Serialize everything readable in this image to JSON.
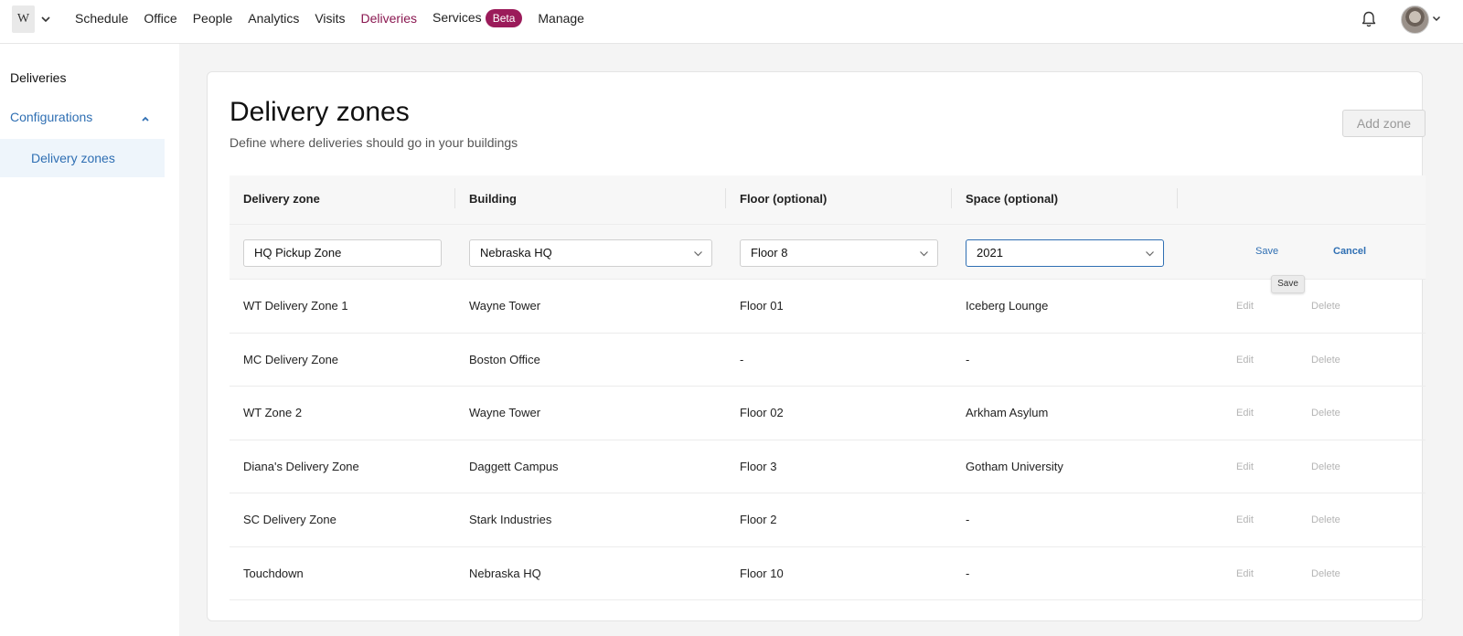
{
  "topnav": {
    "logo_text": "W",
    "items": [
      {
        "label": "Schedule",
        "active": false
      },
      {
        "label": "Office",
        "active": false
      },
      {
        "label": "People",
        "active": false
      },
      {
        "label": "Analytics",
        "active": false
      },
      {
        "label": "Visits",
        "active": false
      },
      {
        "label": "Deliveries",
        "active": true
      },
      {
        "label": "Services",
        "active": false
      },
      {
        "label": "Manage",
        "active": false
      }
    ],
    "services_badge": "Beta",
    "icons": [
      "chevron-down-icon",
      "bell-icon",
      "avatar"
    ]
  },
  "sidebar": {
    "deliveries": "Deliveries",
    "configurations": "Configurations",
    "delivery_zones": "Delivery zones"
  },
  "page": {
    "title": "Delivery zones",
    "subtitle": "Define where deliveries should go in your buildings",
    "add_zone": "Add zone"
  },
  "table": {
    "headers": {
      "zone": "Delivery zone",
      "building": "Building",
      "floor": "Floor (optional)",
      "space": "Space (optional)"
    },
    "edit_row": {
      "zone": "HQ Pickup Zone",
      "building": "Nebraska HQ",
      "floor": "Floor 8",
      "space": "2021",
      "save": "Save",
      "cancel": "Cancel",
      "tooltip": "Save"
    },
    "rows": [
      {
        "zone": "WT Delivery Zone 1",
        "building": "Wayne Tower",
        "floor": "Floor 01",
        "space": "Iceberg Lounge",
        "edit": "Edit",
        "delete": "Delete"
      },
      {
        "zone": "MC Delivery Zone",
        "building": "Boston Office",
        "floor": "-",
        "space": "-",
        "edit": "Edit",
        "delete": "Delete"
      },
      {
        "zone": "WT Zone 2",
        "building": "Wayne Tower",
        "floor": "Floor 02",
        "space": "Arkham Asylum",
        "edit": "Edit",
        "delete": "Delete"
      },
      {
        "zone": "Diana's Delivery Zone",
        "building": "Daggett Campus",
        "floor": "Floor 3",
        "space": "Gotham University",
        "edit": "Edit",
        "delete": "Delete"
      },
      {
        "zone": "SC Delivery Zone",
        "building": "Stark Industries",
        "floor": "Floor 2",
        "space": "-",
        "edit": "Edit",
        "delete": "Delete"
      },
      {
        "zone": "Touchdown",
        "building": "Nebraska HQ",
        "floor": "Floor 10",
        "space": "-",
        "edit": "Edit",
        "delete": "Delete"
      }
    ]
  },
  "colors": {
    "brand": "#9b1b5a",
    "active_nav": "#8a1750",
    "link": "#2f6fb3"
  }
}
